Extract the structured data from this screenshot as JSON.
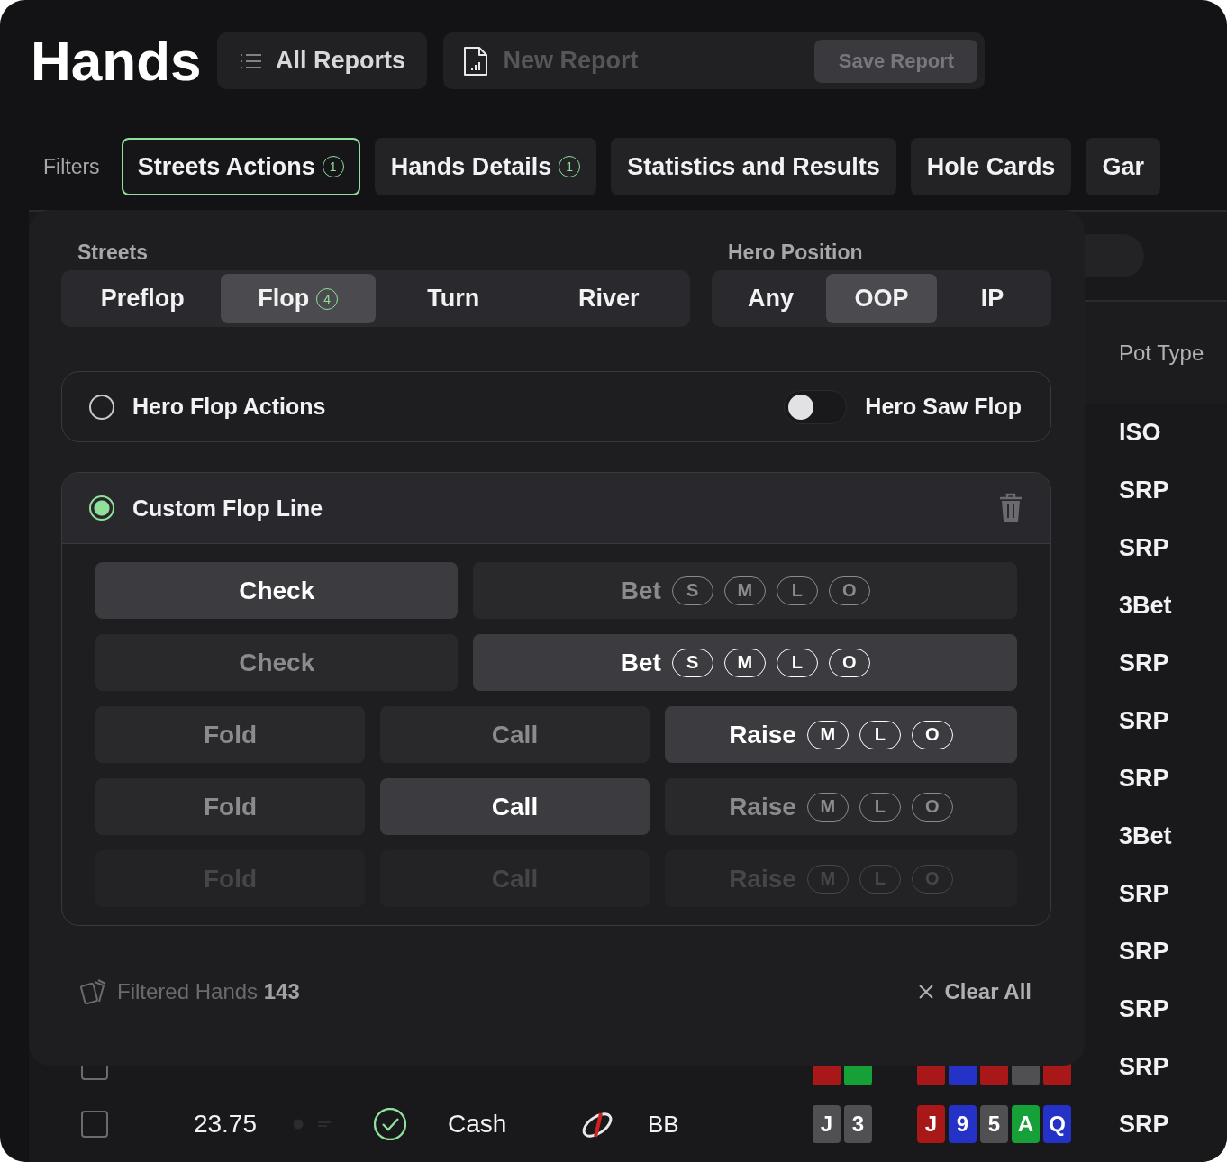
{
  "header": {
    "title": "Hands",
    "all_reports": "All Reports",
    "report_placeholder": "New Report",
    "save_button": "Save Report"
  },
  "filters": {
    "label": "Filters",
    "tabs": [
      {
        "label": "Streets Actions",
        "badge": "1",
        "selected": true
      },
      {
        "label": "Hands Details",
        "badge": "1",
        "selected": false
      },
      {
        "label": "Statistics and Results",
        "selected": false
      },
      {
        "label": "Hole Cards",
        "selected": false
      },
      {
        "label": "Gar",
        "selected": false
      }
    ]
  },
  "table": {
    "pot_type_header": "Pot Type",
    "rows": [
      {
        "pot_type": "ISO"
      },
      {
        "pot_type": "SRP"
      },
      {
        "pot_type": "SRP"
      },
      {
        "pot_type": "3Bet"
      },
      {
        "pot_type": "SRP"
      },
      {
        "pot_type": "SRP"
      },
      {
        "pot_type": "SRP"
      },
      {
        "pot_type": "3Bet"
      },
      {
        "pot_type": "SRP"
      },
      {
        "pot_type": "SRP"
      },
      {
        "pot_type": "SRP"
      },
      {
        "checked": false,
        "hole_cards": [
          {
            "color": "#a81818"
          },
          {
            "color": "#16a038"
          }
        ],
        "board": [
          {
            "color": "#a81818"
          },
          {
            "color": "#2432c8"
          },
          {
            "color": "#a81818"
          },
          {
            "color": "#505052"
          },
          {
            "color": "#a81818"
          }
        ],
        "pot_type": "SRP"
      },
      {
        "checked": false,
        "amount": "23.75",
        "game": "Cash",
        "position": "BB",
        "hole_cards": [
          {
            "rank": "J",
            "color": "#505052"
          },
          {
            "rank": "3",
            "color": "#505052"
          }
        ],
        "board": [
          {
            "rank": "J",
            "color": "#a81818"
          },
          {
            "rank": "9",
            "color": "#2432c8"
          },
          {
            "rank": "5",
            "color": "#505052"
          },
          {
            "rank": "A",
            "color": "#16a038"
          },
          {
            "rank": "Q",
            "color": "#2432c8"
          }
        ],
        "pot_type": "SRP"
      }
    ]
  },
  "popup": {
    "streets_label": "Streets",
    "streets": [
      {
        "label": "Preflop",
        "selected": false
      },
      {
        "label": "Flop",
        "badge": "4",
        "selected": true
      },
      {
        "label": "Turn",
        "selected": false
      },
      {
        "label": "River",
        "selected": false
      }
    ],
    "position_label": "Hero Position",
    "positions": [
      {
        "label": "Any",
        "selected": false
      },
      {
        "label": "OOP",
        "selected": true
      },
      {
        "label": "IP",
        "selected": false
      }
    ],
    "hero_actions": {
      "label": "Hero Flop Actions",
      "selected": false,
      "toggle_label": "Hero Saw Flop",
      "toggle_on": false
    },
    "custom_line": {
      "label": "Custom Flop Line",
      "selected": true,
      "rows": [
        [
          {
            "label": "Check",
            "selected": true,
            "disabled": false
          },
          {
            "label": "Bet",
            "sizes": [
              "S",
              "M",
              "L",
              "O"
            ],
            "selected": false,
            "disabled": false
          }
        ],
        [
          {
            "label": "Check",
            "selected": false,
            "disabled": false
          },
          {
            "label": "Bet",
            "sizes": [
              "S",
              "M",
              "L",
              "O"
            ],
            "selected": true,
            "disabled": false
          }
        ],
        [
          {
            "label": "Fold",
            "selected": false,
            "disabled": false
          },
          {
            "label": "Call",
            "selected": false,
            "disabled": false
          },
          {
            "label": "Raise",
            "sizes": [
              "M",
              "L",
              "O"
            ],
            "selected": true,
            "disabled": false
          }
        ],
        [
          {
            "label": "Fold",
            "selected": false,
            "disabled": false
          },
          {
            "label": "Call",
            "selected": true,
            "disabled": false
          },
          {
            "label": "Raise",
            "sizes": [
              "M",
              "L",
              "O"
            ],
            "selected": false,
            "disabled": false
          }
        ],
        [
          {
            "label": "Fold",
            "selected": false,
            "disabled": true
          },
          {
            "label": "Call",
            "selected": false,
            "disabled": true
          },
          {
            "label": "Raise",
            "sizes": [
              "M",
              "L",
              "O"
            ],
            "selected": false,
            "disabled": true
          }
        ]
      ]
    },
    "filtered": "Filtered Hands **143**",
    "clear": "Clear All"
  }
}
